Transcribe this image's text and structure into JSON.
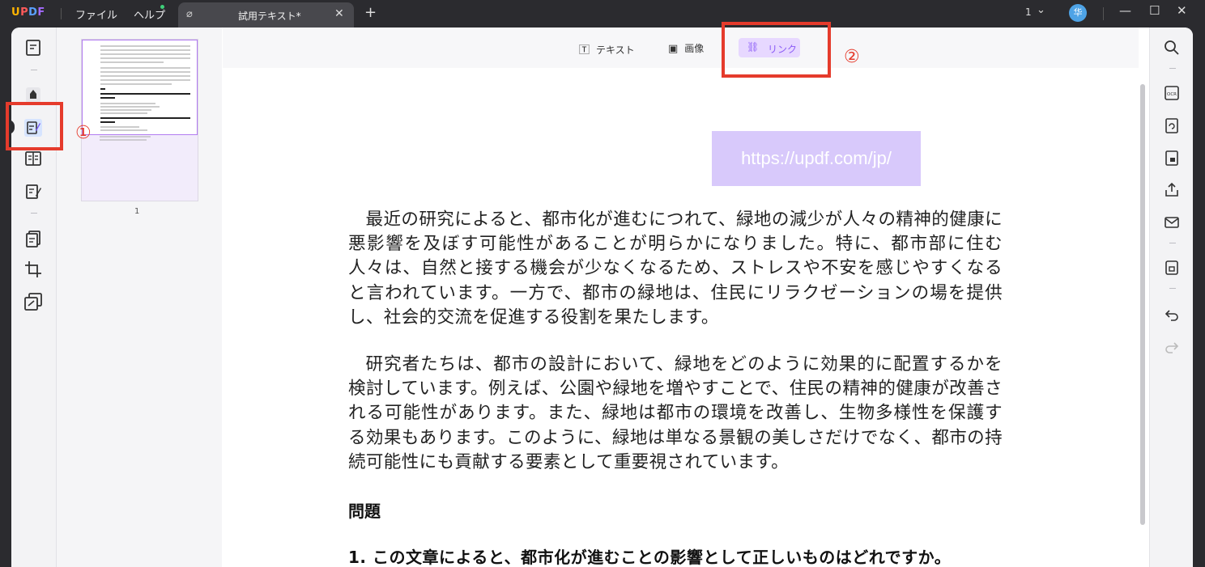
{
  "app": {
    "logo": "UPDF"
  },
  "menu": {
    "file": "ファイル",
    "help": "ヘルプ"
  },
  "tab": {
    "title": "試用テキスト*",
    "close": "✕",
    "add": "+"
  },
  "window": {
    "page_count": "1",
    "minimize": "—",
    "maximize": "☐",
    "close": "✕",
    "avatar_initial": "华"
  },
  "edit_toolbar": {
    "text_label": "テキスト",
    "image_label": "画像",
    "link_label": "リンク"
  },
  "thumbnail": {
    "page_number": "1"
  },
  "document": {
    "link_text": "https://updf.com/jp/",
    "paragraph1": "最近の研究によると、都市化が進むにつれて、緑地の減少が人々の精神的健康に悪影響を及ぼす可能性があることが明らかになりました。特に、都市部に住む人々は、自然と接する機会が少なくなるため、ストレスや不安を感じやすくなると言われています。一方で、都市の緑地は、住民にリラクゼーションの場を提供し、社会的交流を促進する役割を果たします。",
    "paragraph2": "研究者たちは、都市の設計において、緑地をどのように効果的に配置するかを検討しています。例えば、公園や緑地を増やすことで、住民の精神的健康が改善される可能性があります。また、緑地は都市の環境を改善し、生物多様性を保護する効果もあります。このように、緑地は単なる景観の美しさだけでなく、都市の持続可能性にも貢献する要素として重要視されています。",
    "question_heading": "問題",
    "question1": "1.  この文章によると、都市化が進むことの影響として正しいものはどれですか。"
  },
  "annotations": {
    "marker1": "①",
    "marker2": "②"
  },
  "colors": {
    "accent": "#8b5cf6",
    "annotation_red": "#e53b2c",
    "link_highlight": "#d8c9fb"
  }
}
